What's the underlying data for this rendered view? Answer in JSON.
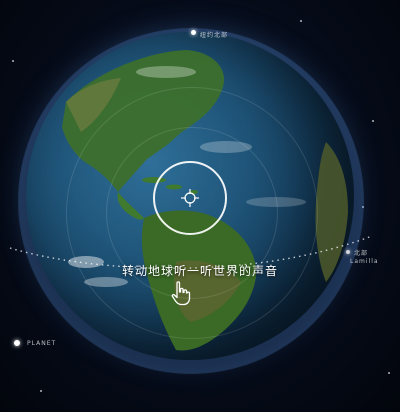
{
  "hint": {
    "text": "转动地球听一听世界的声音"
  },
  "labels": {
    "top_marker": "纽约北部",
    "right_marker": "北部",
    "right_marker_sub": "Lamilla",
    "left_marker": "PLANET"
  },
  "colors": {
    "ocean": "#1f5478",
    "land_green": "#3f7a2e",
    "land_brown": "#7a6a3c",
    "ring_white": "#ffffff"
  }
}
